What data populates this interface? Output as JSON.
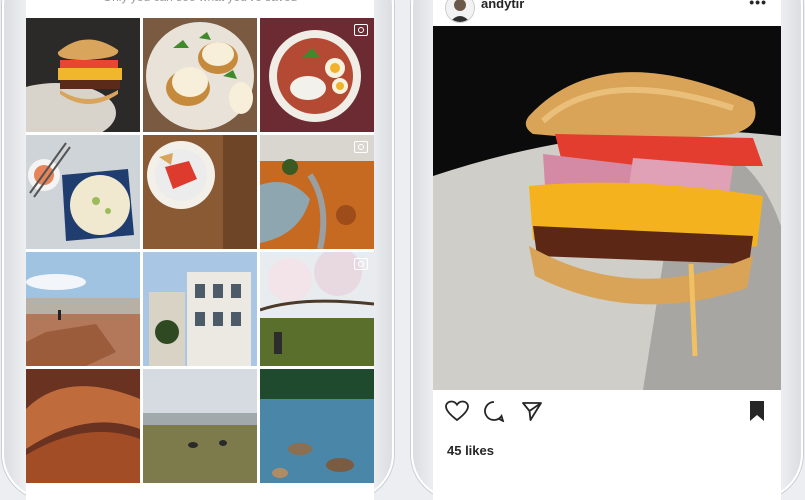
{
  "left_phone": {
    "saved_hint": "Only you can see what you've saved",
    "icons": [
      "multiple-photos-icon"
    ]
  },
  "right_phone": {
    "username": "andytir",
    "more_label": "•••",
    "likes_text": "45 likes",
    "icons": [
      "heart-icon",
      "comment-icon",
      "send-icon",
      "bookmark-icon",
      "more-options-icon"
    ]
  },
  "colors": {
    "text": "#262626",
    "muted": "#999999",
    "divider": "#e6e6e6"
  }
}
